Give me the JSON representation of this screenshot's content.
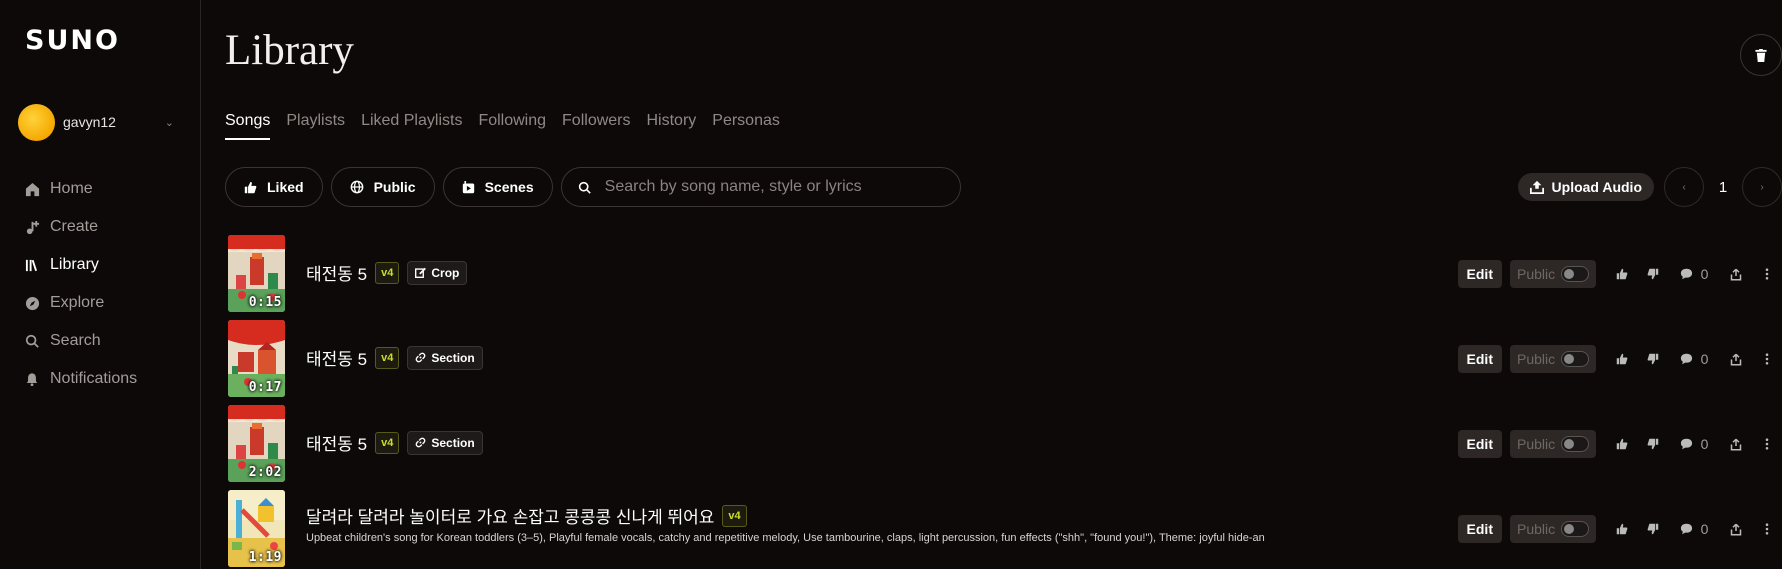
{
  "sidebar": {
    "logo": "SUNO",
    "username": "gavyn12",
    "items": [
      {
        "label": "Home",
        "icon": "home-icon"
      },
      {
        "label": "Create",
        "icon": "create-icon"
      },
      {
        "label": "Library",
        "icon": "library-icon",
        "active": true
      },
      {
        "label": "Explore",
        "icon": "explore-icon"
      },
      {
        "label": "Search",
        "icon": "search-icon"
      },
      {
        "label": "Notifications",
        "icon": "bell-icon"
      }
    ]
  },
  "main": {
    "title": "Library",
    "tabs": [
      {
        "label": "Songs",
        "active": true
      },
      {
        "label": "Playlists"
      },
      {
        "label": "Liked Playlists"
      },
      {
        "label": "Following"
      },
      {
        "label": "Followers"
      },
      {
        "label": "History"
      },
      {
        "label": "Personas"
      }
    ],
    "filters": {
      "liked": "Liked",
      "public": "Public",
      "scenes": "Scenes",
      "search_placeholder": "Search by song name, style or lyrics"
    },
    "upload_label": "Upload Audio",
    "page": "1"
  },
  "songs": [
    {
      "title": "태전동 5",
      "version": "v4",
      "tag": "Crop",
      "tag_icon": "edit-icon",
      "duration": "0:15",
      "edit": "Edit",
      "public": "Public",
      "comments": "0",
      "description": ""
    },
    {
      "title": "태전동 5",
      "version": "v4",
      "tag": "Section",
      "tag_icon": "link-icon",
      "duration": "0:17",
      "edit": "Edit",
      "public": "Public",
      "comments": "0",
      "description": ""
    },
    {
      "title": "태전동 5",
      "version": "v4",
      "tag": "Section",
      "tag_icon": "link-icon",
      "duration": "2:02",
      "edit": "Edit",
      "public": "Public",
      "comments": "0",
      "description": ""
    },
    {
      "title": "달려라 달려라 놀이터로 가요 손잡고 콩콩콩 신나게 뛰어요",
      "version": "v4",
      "tag": "",
      "duration": "1:19",
      "edit": "Edit",
      "public": "Public",
      "comments": "0",
      "description": "Upbeat children's song for Korean toddlers (3–5), Playful female vocals, catchy and repetitive melody, Use tambourine, claps, light percussion, fun effects (\"shh\", \"found you!\"), Theme: joyful hide-an"
    }
  ],
  "colors": {
    "background": "#0d0908",
    "accent_version": "#c8e02a",
    "avatar": "#f5a800"
  }
}
